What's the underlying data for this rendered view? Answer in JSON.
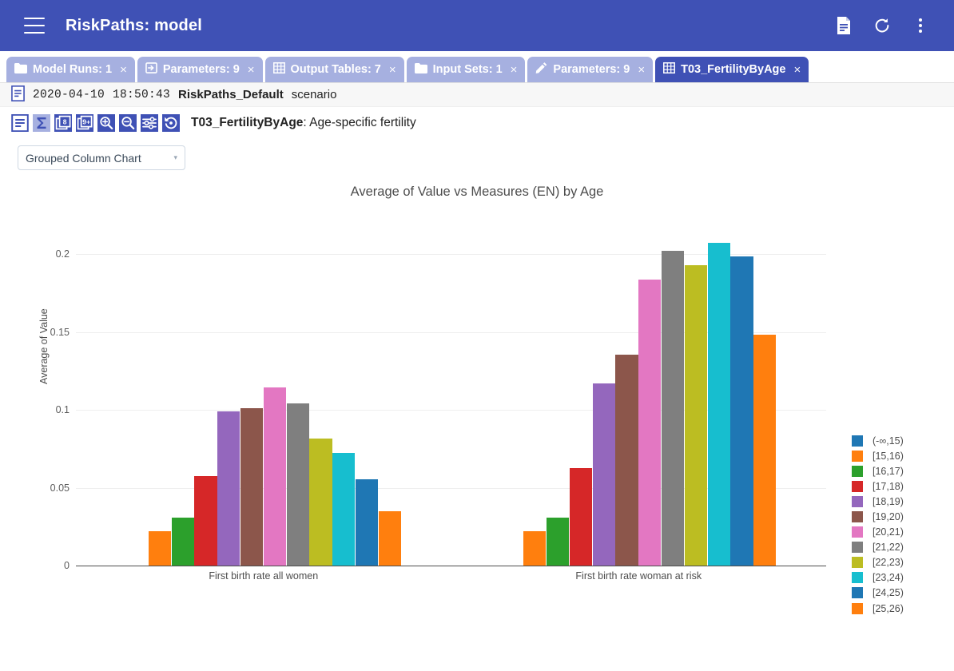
{
  "appbar": {
    "title": "RiskPaths: model",
    "menu_icon": "hamburger-icon",
    "actions": [
      {
        "name": "document-icon"
      },
      {
        "name": "refresh-icon"
      },
      {
        "name": "more-vert-icon"
      }
    ],
    "bg": "#3f51b5"
  },
  "tabs": [
    {
      "label": "Model Runs: 1",
      "icon": "folder-icon",
      "active": false
    },
    {
      "label": "Parameters: 9",
      "icon": "arrow-in-box-icon",
      "active": false
    },
    {
      "label": "Output Tables: 7",
      "icon": "table-grid-icon",
      "active": false
    },
    {
      "label": "Input Sets: 1",
      "icon": "folder-icon",
      "active": false
    },
    {
      "label": "Parameters: 9",
      "icon": "pencil-icon",
      "active": false
    },
    {
      "label": "T03_FertilityByAge",
      "icon": "table-grid-icon",
      "active": true
    }
  ],
  "tab_close_label": "×",
  "scenario": {
    "icon": "document-icon",
    "date": "2020-04-10",
    "time": "18:50:43",
    "name": "RiskPaths_Default",
    "suffix": "scenario"
  },
  "toolbar": {
    "icons": [
      {
        "name": "document-icon"
      },
      {
        "name": "sigma-icon"
      },
      {
        "name": "decimals-8-icon"
      },
      {
        "name": "decimals-9plus-icon"
      },
      {
        "name": "zoom-in-icon"
      },
      {
        "name": "zoom-out-icon"
      },
      {
        "name": "filter-settings-icon"
      },
      {
        "name": "reset-icon"
      }
    ],
    "table_id": "T03_FertilityByAge",
    "table_desc": ": Age-specific fertility"
  },
  "chart_select": {
    "value": "Grouped Column Chart",
    "caret": "▾"
  },
  "chart_data": {
    "type": "bar",
    "title": "Average of Value vs Measures (EN) by Age",
    "xlabel": "",
    "ylabel": "Average of Value",
    "categories": [
      "First birth rate all women",
      "First birth rate woman at risk"
    ],
    "ylim": [
      0,
      0.2
    ],
    "yticks": [
      0,
      0.05,
      0.1,
      0.15,
      0.2
    ],
    "ytick_labels": [
      "0",
      "0.05",
      "0.1",
      "0.15",
      "0.2"
    ],
    "grid": true,
    "legend_position": "right",
    "series": [
      {
        "name": "(-∞,15)",
        "color": "#1f77b4",
        "values": [
          0,
          0
        ]
      },
      {
        "name": "[15,16)",
        "color": "#ff7f0e",
        "values": [
          0.0221,
          0.0221
        ]
      },
      {
        "name": "[16,17)",
        "color": "#2ca02c",
        "values": [
          0.031,
          0.031
        ]
      },
      {
        "name": "[17,18)",
        "color": "#d62728",
        "values": [
          0.0575,
          0.0625
        ]
      },
      {
        "name": "[18,19)",
        "color": "#9467bd",
        "values": [
          0.0992,
          0.1168
        ]
      },
      {
        "name": "[19,20)",
        "color": "#8c564b",
        "values": [
          0.1008,
          0.1353
        ]
      },
      {
        "name": "[20,21)",
        "color": "#e377c2",
        "values": [
          0.1142,
          0.1838
        ]
      },
      {
        "name": "[21,22)",
        "color": "#7f7f7f",
        "values": [
          0.1043,
          0.2022
        ]
      },
      {
        "name": "[22,23)",
        "color": "#bcbd22",
        "values": [
          0.0817,
          0.1927
        ]
      },
      {
        "name": "[23,24)",
        "color": "#17becf",
        "values": [
          0.0721,
          0.2072
        ]
      },
      {
        "name": "[24,25)",
        "color": "#1f77b4",
        "values": [
          0.0556,
          0.1983
        ]
      },
      {
        "name": "[25,26)",
        "color": "#ff7f0e",
        "values": [
          0.035,
          0.1482
        ]
      }
    ]
  }
}
